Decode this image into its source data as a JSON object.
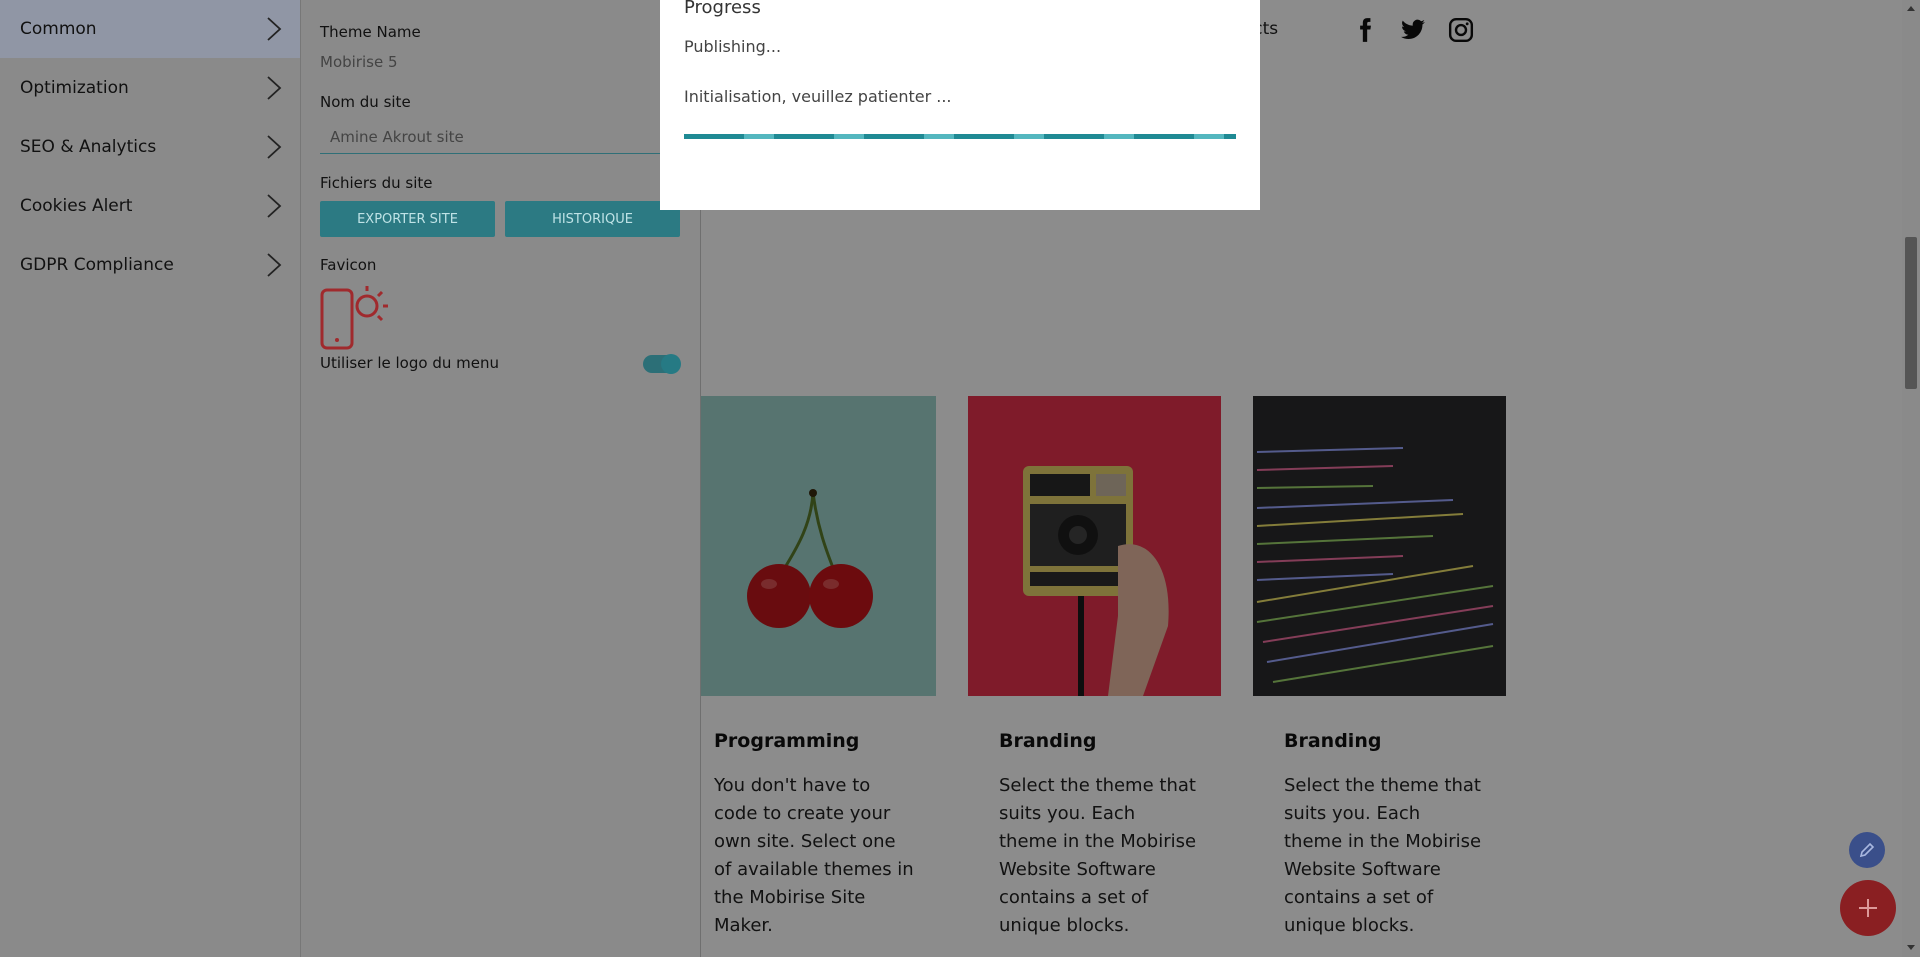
{
  "menu": {
    "items": [
      {
        "label": "Common",
        "active": true
      },
      {
        "label": "Optimization"
      },
      {
        "label": "SEO & Analytics"
      },
      {
        "label": "Cookies Alert"
      },
      {
        "label": "GDPR Compliance"
      }
    ]
  },
  "panel": {
    "theme_name_label": "Theme Name",
    "theme_name_value": "Mobirise 5",
    "site_name_label": "Nom du site",
    "site_name_placeholder": "Amine Akrout site",
    "site_files_label": "Fichiers du site",
    "export_button": "EXPORTER SITE",
    "history_button": "HISTORIQUE",
    "favicon_label": "Favicon",
    "use_menu_logo_label": "Utiliser le logo du menu",
    "use_menu_logo_enabled": true
  },
  "modal": {
    "title": "Progress",
    "status": "Publishing...",
    "message": "Initialisation, veuillez patienter ...",
    "progress": 1.0
  },
  "site": {
    "nav_link": "ontacts",
    "social_icons": [
      "facebook-icon",
      "twitter-icon",
      "instagram-icon"
    ],
    "cards": [
      {
        "title": "Programming",
        "text": "You don't have to code to create your own site. Select one of available themes in the Mobirise Site Maker."
      },
      {
        "title": "Branding",
        "text": "Select the theme that suits you. Each theme in the Mobirise Website Software contains a set of unique blocks."
      },
      {
        "title": "Branding",
        "text": "Select the theme that suits you. Each theme in the Mobirise Website Software contains a set of unique blocks."
      }
    ]
  },
  "colors": {
    "accent": "#2c7a83",
    "fab_add": "#c0292e",
    "fab_edit": "#4a67b8"
  }
}
